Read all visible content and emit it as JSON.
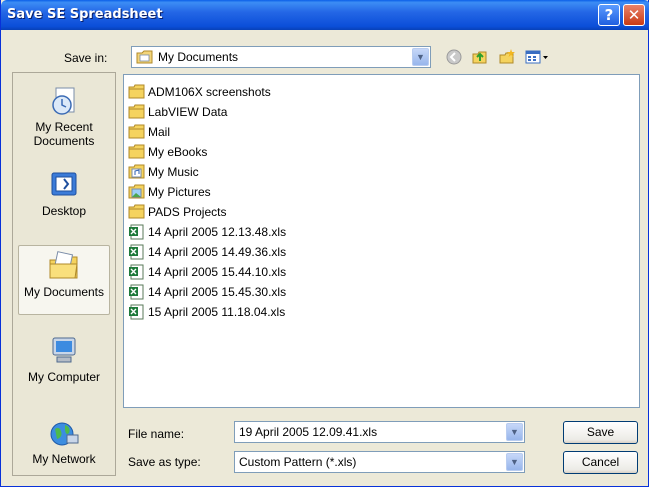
{
  "window": {
    "title": "Save SE Spreadsheet",
    "help_glyph": "?",
    "close_glyph": "✕"
  },
  "save_in": {
    "label": "Save in:",
    "value": "My Documents"
  },
  "places": [
    {
      "label_line1": "My Recent",
      "label_line2": "Documents",
      "icon": "recent-documents-icon"
    },
    {
      "label_line1": "Desktop",
      "label_line2": "",
      "icon": "desktop-icon"
    },
    {
      "label_line1": "My Documents",
      "label_line2": "",
      "icon": "my-documents-icon"
    },
    {
      "label_line1": "My Computer",
      "label_line2": "",
      "icon": "my-computer-icon"
    },
    {
      "label_line1": "My Network",
      "label_line2": "",
      "icon": "my-network-icon"
    }
  ],
  "files": [
    {
      "name": "ADM106X screenshots",
      "type": "folder"
    },
    {
      "name": "LabVIEW Data",
      "type": "folder"
    },
    {
      "name": "Mail",
      "type": "folder"
    },
    {
      "name": "My eBooks",
      "type": "folder"
    },
    {
      "name": "My Music",
      "type": "music-folder"
    },
    {
      "name": "My Pictures",
      "type": "pictures-folder"
    },
    {
      "name": "PADS Projects",
      "type": "folder"
    },
    {
      "name": "14 April 2005 12.13.48.xls",
      "type": "xls"
    },
    {
      "name": "14 April 2005 14.49.36.xls",
      "type": "xls"
    },
    {
      "name": "14 April 2005 15.44.10.xls",
      "type": "xls"
    },
    {
      "name": "14 April 2005 15.45.30.xls",
      "type": "xls"
    },
    {
      "name": "15 April 2005 11.18.04.xls",
      "type": "xls"
    }
  ],
  "file_name": {
    "label": "File name:",
    "value": "19 April 2005 12.09.41.xls"
  },
  "save_as_type": {
    "label": "Save as type:",
    "value": "Custom Pattern (*.xls)"
  },
  "buttons": {
    "save": "Save",
    "cancel": "Cancel"
  },
  "colors": {
    "titlebar": "#0B4ED8",
    "folder": "#F5D35E",
    "xls": "#1E7A3A"
  }
}
